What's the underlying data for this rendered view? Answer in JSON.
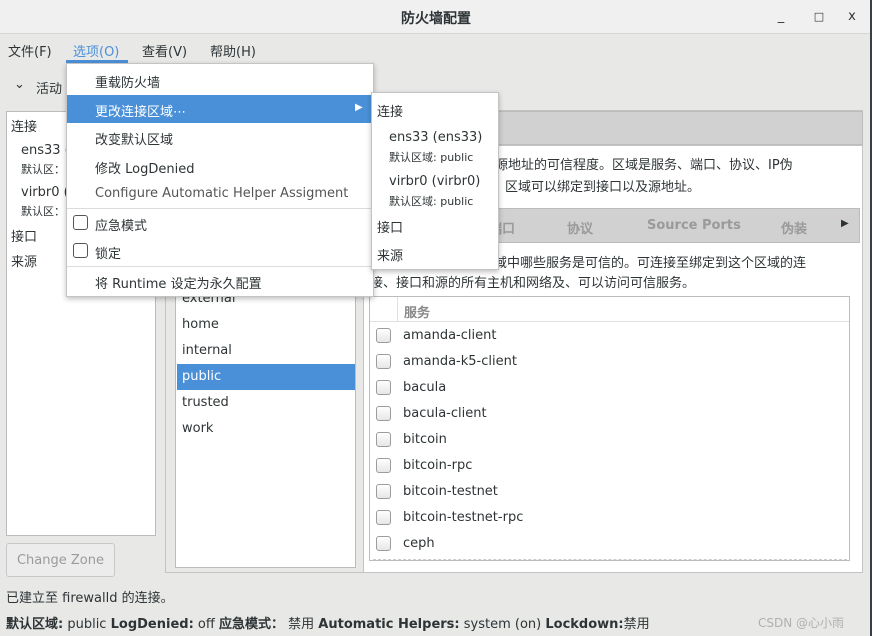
{
  "window": {
    "title": "防火墙配置",
    "minimize": "_",
    "maximize": "□",
    "close": "x"
  },
  "menubar": [
    "文件(F)",
    "选项(O)",
    "查看(V)",
    "帮助(H)"
  ],
  "active_bindings": {
    "label": "活动"
  },
  "left_panel": {
    "connections_header": "连接",
    "connections": [
      {
        "name": "ens33 (",
        "zone": "默认区："
      },
      {
        "name": "virbr0 (",
        "zone": "默认区："
      }
    ],
    "interfaces": "接口",
    "sources": "来源",
    "change_zone": "Change Zone"
  },
  "zone_description": [
    "源地址的可信程度。区域是服务、端口、协议、IP伪",
    "。区域可以绑定到接口以及源地址。"
  ],
  "tabs": {
    "items": [
      "端口",
      "协议",
      "Source Ports",
      "伪装"
    ]
  },
  "services_description": [
    "域中哪些服务是可信的。可连接至绑定到这个区域的连",
    "接、接口和源的所有主机和网络及、可以访问可信服务。"
  ],
  "zones": {
    "items": [
      "external",
      "home",
      "internal",
      "public",
      "trusted",
      "work"
    ],
    "selected": "public"
  },
  "services": {
    "header": "服务",
    "items": [
      "amanda-client",
      "amanda-k5-client",
      "bacula",
      "bacula-client",
      "bitcoin",
      "bitcoin-rpc",
      "bitcoin-testnet",
      "bitcoin-testnet-rpc",
      "ceph"
    ]
  },
  "options_menu": {
    "reload": "重载防火墙",
    "change_conn_zone": "更改连接区域⋯",
    "change_default_zone": "改变默认区域",
    "modify_logdenied": "修改  LogDenied",
    "configure_helper": "Configure Automatic Helper Assigment",
    "panic_mode": "应急模式",
    "lockdown": "锁定",
    "runtime_to_permanent": "将  Runtime 设定为永久配置"
  },
  "submenu": {
    "connections_header": "连接",
    "connections": [
      {
        "name": "ens33 (ens33)",
        "zone_label": "默认区域:",
        "zone": "public"
      },
      {
        "name": "virbr0 (virbr0)",
        "zone_label": "默认区域:",
        "zone": "public"
      }
    ],
    "interfaces": "接口",
    "sources": "来源"
  },
  "status": {
    "message": "已建立至  firewalld 的连接。",
    "default_zone_label": "默认区域:",
    "default_zone": "public",
    "logdenied_label": "LogDenied:",
    "logdenied": "off",
    "panic_label": "应急模式：",
    "panic": "禁用",
    "helpers_label": "Automatic Helpers:",
    "helpers": "system (on)",
    "lockdown_label": "Lockdown:",
    "lockdown": "禁用"
  },
  "watermark": "CSDN @心小雨",
  "colors": {
    "accent": "#4a90d9"
  }
}
